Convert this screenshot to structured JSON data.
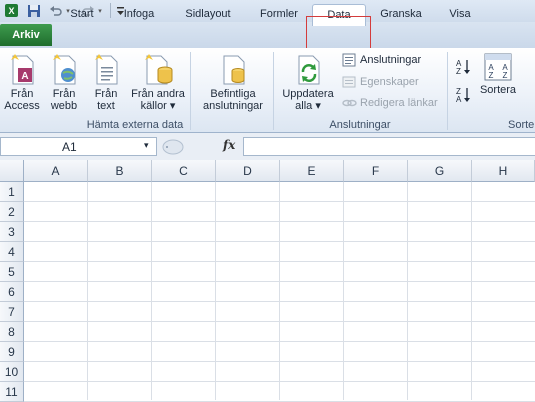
{
  "tabs": {
    "file": "Arkiv",
    "items": [
      "Start",
      "Infoga",
      "Sidlayout",
      "Formler",
      "Data",
      "Granska",
      "Visa"
    ]
  },
  "ribbon": {
    "get_external": {
      "from_access": "Från\nAccess",
      "from_web": "Från\nwebb",
      "from_text": "Från\ntext",
      "from_other": "Från andra\nkällor ▾",
      "label": "Hämta externa data"
    },
    "existing_connections": "Befintliga\nanslutningar",
    "connections": {
      "refresh_all": "Uppdatera\nalla ▾",
      "connections": "Anslutningar",
      "properties": "Egenskaper",
      "edit_links": "Redigera länkar",
      "label": "Anslutningar"
    },
    "sort": {
      "sort": "Sortera",
      "label": "Sorte"
    }
  },
  "formula_bar": {
    "name_box": "A1",
    "fx": "fx",
    "value": ""
  },
  "grid": {
    "columns": [
      "A",
      "B",
      "C",
      "D",
      "E",
      "F",
      "G",
      "H"
    ],
    "rows": [
      "1",
      "2",
      "3",
      "4",
      "5",
      "6",
      "7",
      "8",
      "9",
      "10",
      "11"
    ]
  },
  "colors": {
    "file_tab": "#2a7d3a",
    "highlight": "#d43c3c"
  },
  "icons": [
    "excel-logo-icon",
    "save-icon",
    "undo-icon",
    "redo-icon",
    "customize-qat-icon",
    "access-icon",
    "web-icon",
    "text-file-icon",
    "database-icon",
    "connections-icon",
    "refresh-icon",
    "properties-icon",
    "edit-links-icon",
    "sort-az-icon",
    "sort-za-icon",
    "sort-icon",
    "dropdown-icon"
  ]
}
